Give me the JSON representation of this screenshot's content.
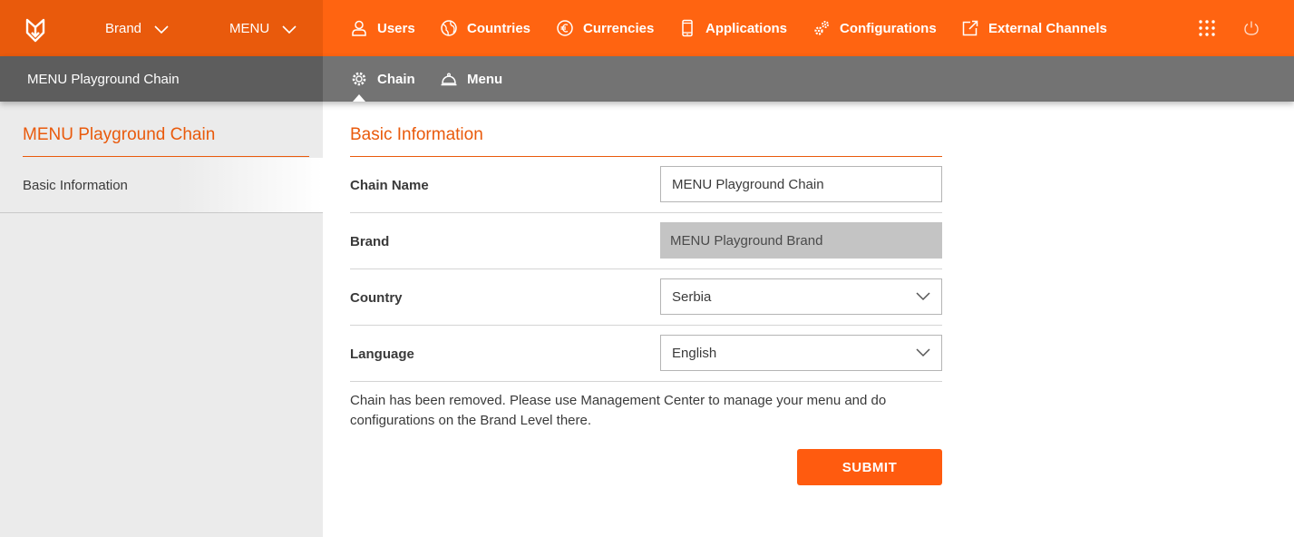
{
  "header": {
    "brand_dropdown": "Brand",
    "menu_dropdown": "MENU",
    "nav": [
      {
        "label": "Users",
        "icon": "user-icon"
      },
      {
        "label": "Countries",
        "icon": "globe-icon"
      },
      {
        "label": "Currencies",
        "icon": "euro-icon"
      },
      {
        "label": "Applications",
        "icon": "mobile-icon"
      },
      {
        "label": "Configurations",
        "icon": "gears-icon"
      },
      {
        "label": "External Channels",
        "icon": "external-link-icon"
      }
    ]
  },
  "subheader": {
    "context_title": "MENU Playground Chain",
    "tabs": [
      {
        "label": "Chain",
        "icon": "gear-icon",
        "active": true
      },
      {
        "label": "Menu",
        "icon": "cloche-icon",
        "active": false
      }
    ]
  },
  "sidebar": {
    "title": "MENU Playground Chain",
    "items": [
      {
        "label": "Basic Information"
      }
    ]
  },
  "form": {
    "section_title": "Basic Information",
    "chain_name": {
      "label": "Chain Name",
      "value": "MENU Playground Chain"
    },
    "brand": {
      "label": "Brand",
      "value": "MENU Playground Brand"
    },
    "country": {
      "label": "Country",
      "value": "Serbia"
    },
    "language": {
      "label": "Language",
      "value": "English"
    },
    "note": "Chain has been removed. Please use Management Center to manage your menu and do configurations on the Brand Level there.",
    "submit_label": "SUBMIT"
  },
  "colors": {
    "accent": "#ff6411",
    "accent_dark": "#e95a0c",
    "subbar": "#737373",
    "sidebar": "#ebebeb"
  }
}
